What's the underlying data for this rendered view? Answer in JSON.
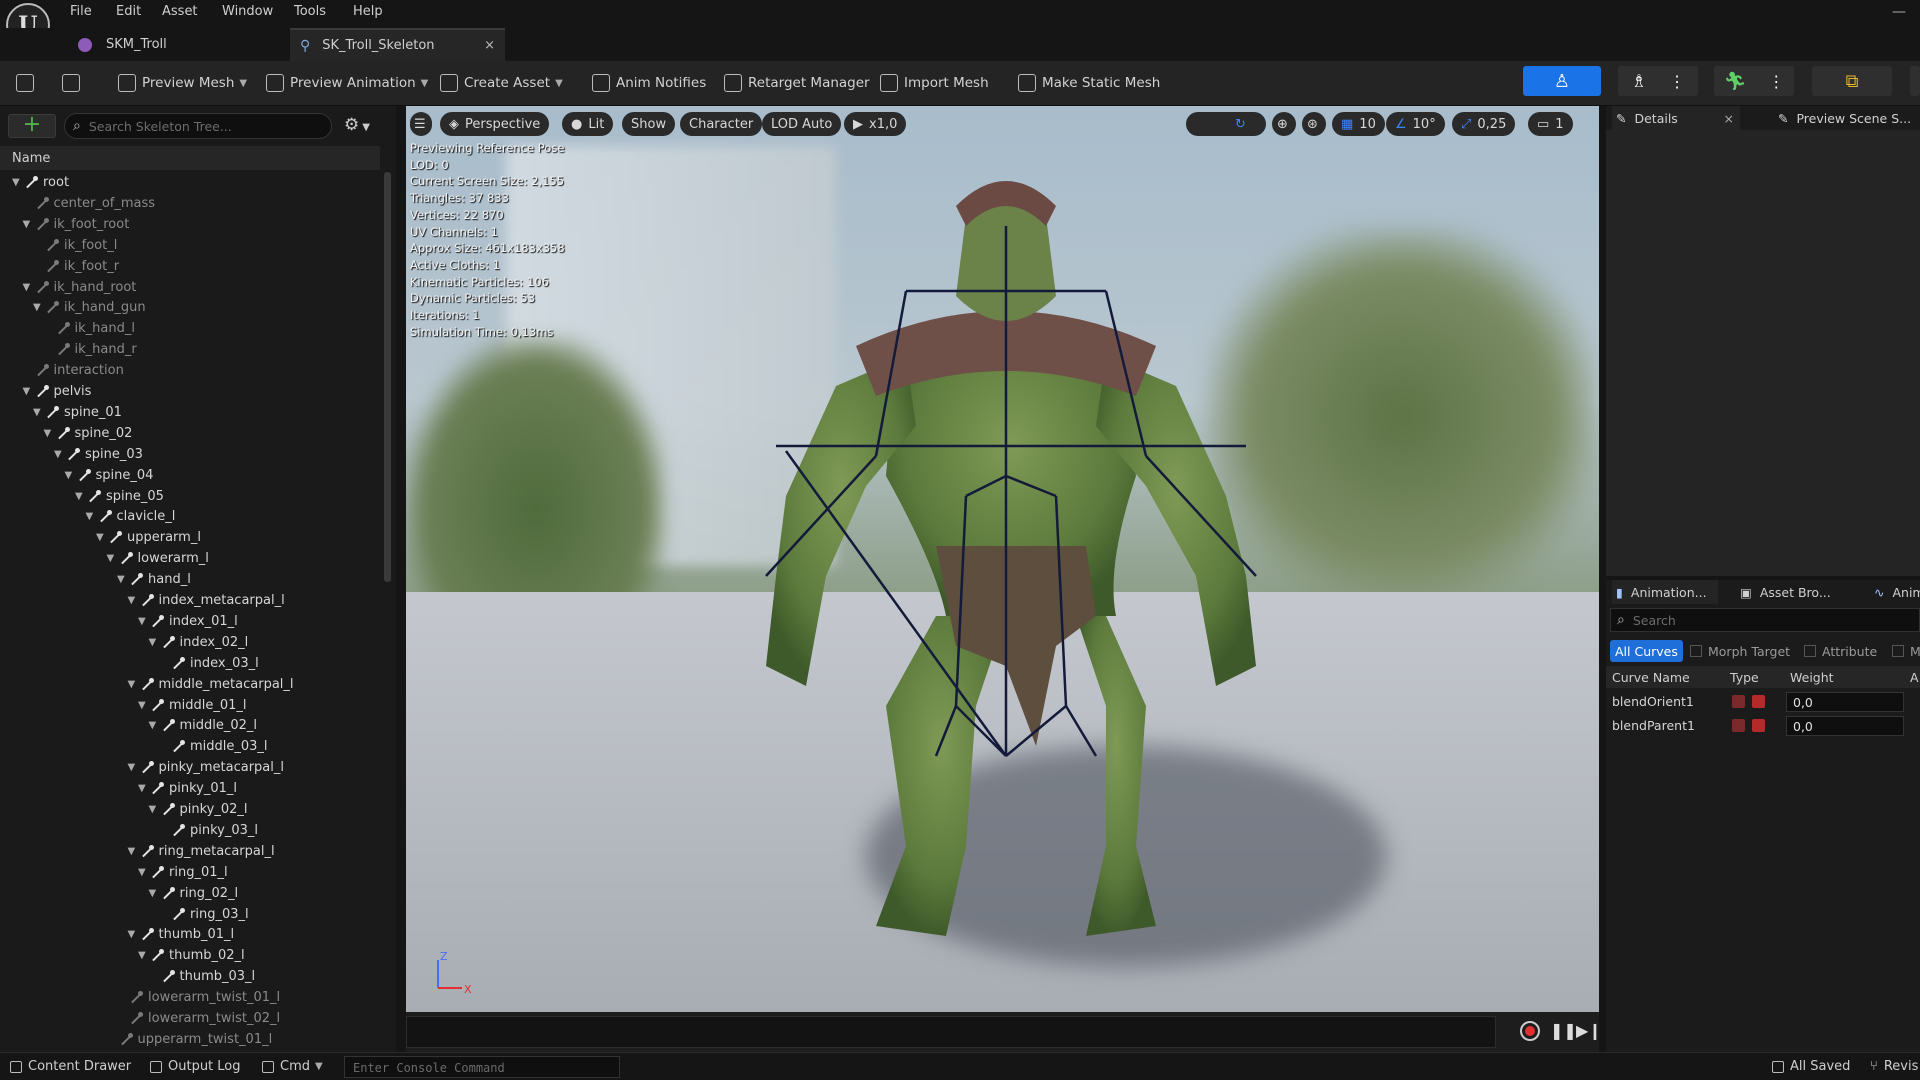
{
  "menu": [
    "File",
    "Edit",
    "Asset",
    "Window",
    "Tools",
    "Help"
  ],
  "tabs": [
    {
      "label": "SKM_Troll",
      "active": false
    },
    {
      "label": "SK_Troll_Skeleton",
      "active": true,
      "close": "×"
    }
  ],
  "toolbar": {
    "preview_mesh": "Preview Mesh",
    "preview_animation": "Preview Animation",
    "create_asset": "Create Asset",
    "anim_notifies": "Anim Notifies",
    "retarget_manager": "Retarget Manager",
    "import_mesh": "Import Mesh",
    "make_static_mesh": "Make Static Mesh",
    "accent": "#1a74e8"
  },
  "skeleton_tree": {
    "search_placeholder": "Search Skeleton Tree...",
    "column_name": "Name",
    "bones": [
      {
        "name": "root",
        "depth": 0,
        "expanded": true,
        "dim": false
      },
      {
        "name": "center_of_mass",
        "depth": 1,
        "dim": true
      },
      {
        "name": "ik_foot_root",
        "depth": 1,
        "expanded": true,
        "dim": true
      },
      {
        "name": "ik_foot_l",
        "depth": 2,
        "dim": true
      },
      {
        "name": "ik_foot_r",
        "depth": 2,
        "dim": true
      },
      {
        "name": "ik_hand_root",
        "depth": 1,
        "expanded": true,
        "dim": true
      },
      {
        "name": "ik_hand_gun",
        "depth": 2,
        "expanded": true,
        "dim": true
      },
      {
        "name": "ik_hand_l",
        "depth": 3,
        "dim": true
      },
      {
        "name": "ik_hand_r",
        "depth": 3,
        "dim": true
      },
      {
        "name": "interaction",
        "depth": 1,
        "dim": true
      },
      {
        "name": "pelvis",
        "depth": 1,
        "expanded": true,
        "dim": false
      },
      {
        "name": "spine_01",
        "depth": 2,
        "expanded": true,
        "dim": false
      },
      {
        "name": "spine_02",
        "depth": 3,
        "expanded": true,
        "dim": false
      },
      {
        "name": "spine_03",
        "depth": 4,
        "expanded": true,
        "dim": false
      },
      {
        "name": "spine_04",
        "depth": 5,
        "expanded": true,
        "dim": false
      },
      {
        "name": "spine_05",
        "depth": 6,
        "expanded": true,
        "dim": false
      },
      {
        "name": "clavicle_l",
        "depth": 7,
        "expanded": true,
        "dim": false
      },
      {
        "name": "upperarm_l",
        "depth": 8,
        "expanded": true,
        "dim": false
      },
      {
        "name": "lowerarm_l",
        "depth": 9,
        "expanded": true,
        "dim": false
      },
      {
        "name": "hand_l",
        "depth": 10,
        "expanded": true,
        "dim": false
      },
      {
        "name": "index_metacarpal_l",
        "depth": 11,
        "expanded": true,
        "dim": false
      },
      {
        "name": "index_01_l",
        "depth": 12,
        "expanded": true,
        "dim": false
      },
      {
        "name": "index_02_l",
        "depth": 13,
        "expanded": true,
        "dim": false
      },
      {
        "name": "index_03_l",
        "depth": 14,
        "dim": false
      },
      {
        "name": "middle_metacarpal_l",
        "depth": 11,
        "expanded": true,
        "dim": false
      },
      {
        "name": "middle_01_l",
        "depth": 12,
        "expanded": true,
        "dim": false
      },
      {
        "name": "middle_02_l",
        "depth": 13,
        "expanded": true,
        "dim": false
      },
      {
        "name": "middle_03_l",
        "depth": 14,
        "dim": false
      },
      {
        "name": "pinky_metacarpal_l",
        "depth": 11,
        "expanded": true,
        "dim": false
      },
      {
        "name": "pinky_01_l",
        "depth": 12,
        "expanded": true,
        "dim": false
      },
      {
        "name": "pinky_02_l",
        "depth": 13,
        "expanded": true,
        "dim": false
      },
      {
        "name": "pinky_03_l",
        "depth": 14,
        "dim": false
      },
      {
        "name": "ring_metacarpal_l",
        "depth": 11,
        "expanded": true,
        "dim": false
      },
      {
        "name": "ring_01_l",
        "depth": 12,
        "expanded": true,
        "dim": false
      },
      {
        "name": "ring_02_l",
        "depth": 13,
        "expanded": true,
        "dim": false
      },
      {
        "name": "ring_03_l",
        "depth": 14,
        "dim": false
      },
      {
        "name": "thumb_01_l",
        "depth": 11,
        "expanded": true,
        "dim": false
      },
      {
        "name": "thumb_02_l",
        "depth": 12,
        "expanded": true,
        "dim": false
      },
      {
        "name": "thumb_03_l",
        "depth": 13,
        "dim": false
      },
      {
        "name": "lowerarm_twist_01_l",
        "depth": 10,
        "dim": true
      },
      {
        "name": "lowerarm_twist_02_l",
        "depth": 10,
        "dim": true
      },
      {
        "name": "upperarm_twist_01_l",
        "depth": 9,
        "dim": true
      }
    ]
  },
  "viewport": {
    "perspective": "Perspective",
    "lit": "Lit",
    "show": "Show",
    "character": "Character",
    "lod": "LOD Auto",
    "play_speed": "x1,0",
    "grid_size": "10",
    "rot_snap": "10°",
    "scale_snap": "0,25",
    "camera_speed": "1",
    "stats": [
      "Previewing Reference Pose",
      "LOD: 0",
      "Current Screen Size: 2,155",
      "Triangles: 37 833",
      "Vertices: 22 870",
      "UV Channels: 1",
      "Approx Size: 461x183x358",
      "Active Cloths: 1",
      "Kinematic Particles: 106",
      "Dynamic Particles: 53",
      "Iterations: 1",
      "Simulation Time: 0,13ms"
    ],
    "axis_z": "Z",
    "axis_x": "X"
  },
  "details": {
    "tab_details": "Details",
    "tab_close": "×",
    "tab_preview": "Preview Scene S..."
  },
  "anim_curves": {
    "tab_animation": "Animation...",
    "tab_asset": "Asset Bro...",
    "tab_anim": "Anim",
    "search_placeholder": "Search",
    "filters": [
      "All Curves",
      "Morph Target",
      "Attribute",
      "M"
    ],
    "col_name": "Curve Name",
    "col_type": "Type",
    "col_weight": "Weight",
    "col_a": "A",
    "curves": [
      {
        "name": "blendOrient1",
        "weight": "0,0"
      },
      {
        "name": "blendParent1",
        "weight": "0,0"
      }
    ]
  },
  "statusbar": {
    "content_drawer": "Content Drawer",
    "output_log": "Output Log",
    "cmd": "Cmd",
    "console_placeholder": "Enter Console Command",
    "all_saved": "All Saved",
    "revision": "Revis"
  }
}
